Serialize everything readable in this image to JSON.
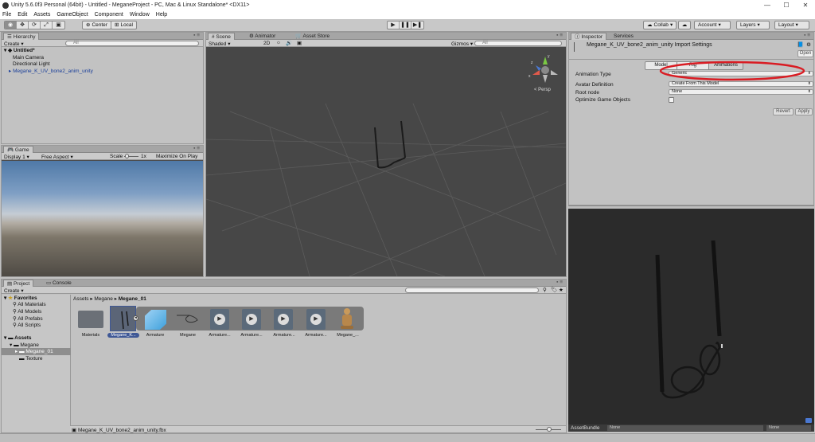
{
  "window": {
    "title": "Unity 5.6.0f3 Personal (64bit) - Untitled - MeganeProject - PC, Mac & Linux Standalone* <DX11>",
    "min": "—",
    "max": "☐",
    "close": "✕"
  },
  "menu": [
    "File",
    "Edit",
    "Assets",
    "GameObject",
    "Component",
    "Window",
    "Help"
  ],
  "toolbar": {
    "pivot": "Center",
    "space": "Local",
    "collab": "Collab",
    "account": "Account",
    "layers": "Layers",
    "layout": "Layout",
    "play": "▶",
    "pause": "❚❚",
    "step": "▶❚"
  },
  "hierarchy": {
    "tab": "Hierarchy",
    "create": "Create",
    "search_placeholder": "All",
    "scene": "Untitled*",
    "items": [
      "Main Camera",
      "Directional Light",
      "Megane_K_UV_bone2_anim_unity"
    ]
  },
  "game": {
    "tab": "Game",
    "display": "Display 1",
    "aspect": "Free Aspect",
    "scale_label": "Scale",
    "scale_value": "1x",
    "maximize": "Maximize On Play"
  },
  "scene": {
    "tabs": [
      "Scene",
      "Animator",
      "Asset Store"
    ],
    "shading": "Shaded",
    "mode_2d": "2D",
    "gizmos": "Gizmos",
    "search_placeholder": "All",
    "persp": "< Persp",
    "axis_x": "x",
    "axis_y": "y",
    "axis_z": "z"
  },
  "inspector": {
    "tabs": [
      "Inspector",
      "Services"
    ],
    "title": "Megane_K_UV_bone2_anim_unity Import Settings",
    "open": "Open",
    "subtabs": [
      "Model",
      "Rig",
      "Animations"
    ],
    "fields": [
      {
        "label": "Animation Type",
        "value": "Generic"
      },
      {
        "label": "Avatar Definition",
        "value": "Create From This Model"
      },
      {
        "label": "Root node",
        "value": "None"
      },
      {
        "label": "Optimize Game Objects",
        "value": ""
      }
    ],
    "revert": "Revert",
    "apply": "Apply",
    "annotation_color": "#d91c23"
  },
  "preview": {
    "assetbundle_label": "AssetBundle",
    "bundle_value": "None",
    "variant_value": "None"
  },
  "project": {
    "tabs": [
      "Project",
      "Console"
    ],
    "create": "Create",
    "favorites_label": "Favorites",
    "favorites": [
      "All Materials",
      "All Models",
      "All Prefabs",
      "All Scripts"
    ],
    "assets_label": "Assets",
    "tree": [
      "Megane",
      "Megane_01",
      "Texture"
    ],
    "breadcrumb": [
      "Assets",
      "Megane",
      "Megane_01"
    ],
    "grid_items": [
      "Materials",
      "Megane_K...",
      "Armature",
      "Megane",
      "Armature...",
      "Armature...",
      "Armature...",
      "Armature...",
      "Megane_..."
    ],
    "selected_path": "Megane_K_UV_bone2_anim_unity.fbx"
  }
}
